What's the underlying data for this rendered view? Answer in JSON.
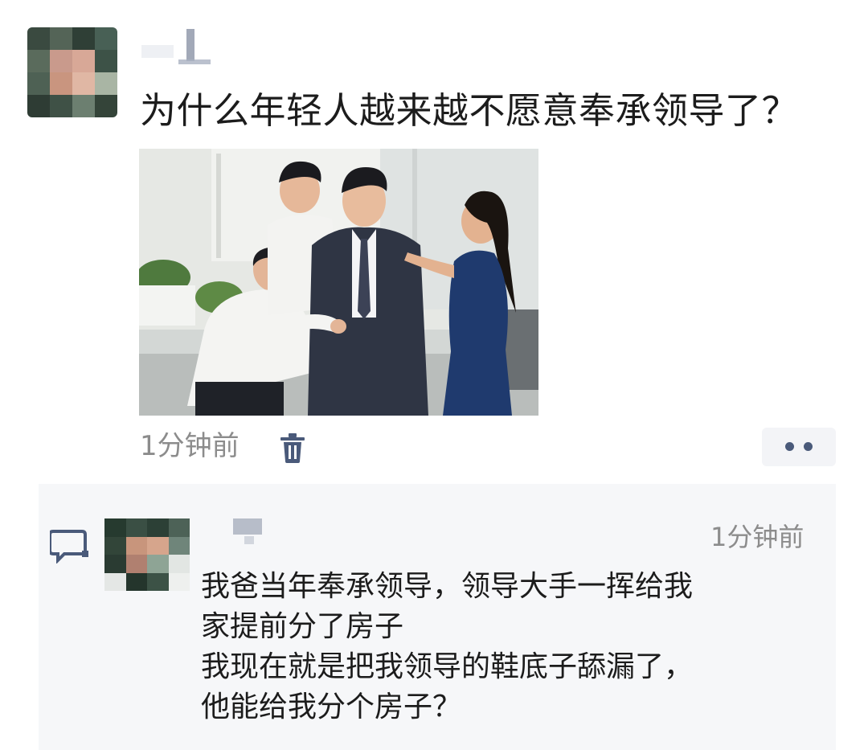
{
  "post": {
    "title": "为什么年轻人越来越不愿意奉承领导了？",
    "time": "1分钟前",
    "avatar_icon": "pixelated-avatar",
    "delete_icon": "trash-icon",
    "more_icon": "more-dots-icon"
  },
  "comment": {
    "time": "1分钟前",
    "icon": "comment-bubble-icon",
    "lines": [
      "我爸当年奉承领导，领导大手一挥给我",
      "家提前分了房子",
      "我现在就是把我领导的鞋底子舔漏了，",
      "他能给我分个房子？"
    ]
  },
  "colors": {
    "text": "#1c1c1c",
    "muted": "#8c8c8c",
    "accent": "#4a5a7a",
    "comment_bg": "#f6f7f9"
  }
}
